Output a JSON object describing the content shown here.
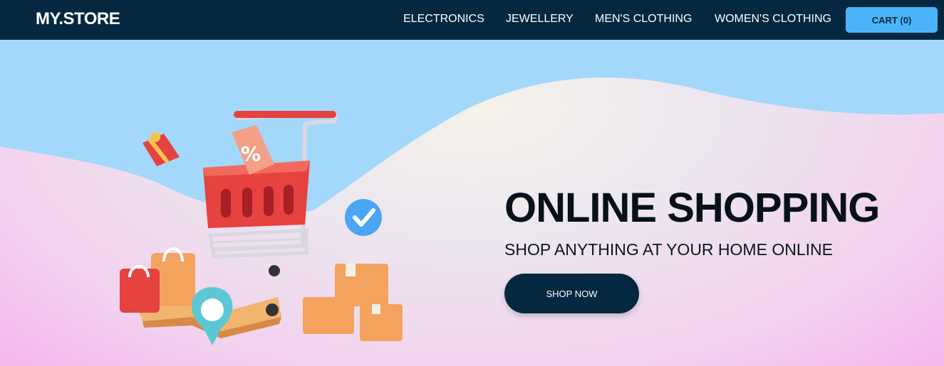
{
  "header": {
    "logo": "MY.STORE",
    "nav": [
      "ELECTRONICS",
      "JEWELLERY",
      "MEN'S CLOTHING",
      "WOMEN'S CLOTHING"
    ],
    "cart_label": "CART (0)"
  },
  "hero": {
    "title": "ONLINE SHOPPING",
    "subtitle": "SHOP ANYTHING AT YOUR HOME ONLINE",
    "cta_label": "SHOP NOW"
  },
  "colors": {
    "header_bg": "#052840",
    "cart_bg": "#4bb4f8",
    "hero_sky": "#a3d8fa",
    "hero_pink": "#f5b6ec"
  },
  "icons": [
    "shopping-cart-icon",
    "discount-tag-icon",
    "gift-box-icon",
    "checkmark-badge-icon",
    "shopping-bag-icon",
    "location-pin-icon",
    "map-icon",
    "package-box-icon"
  ]
}
